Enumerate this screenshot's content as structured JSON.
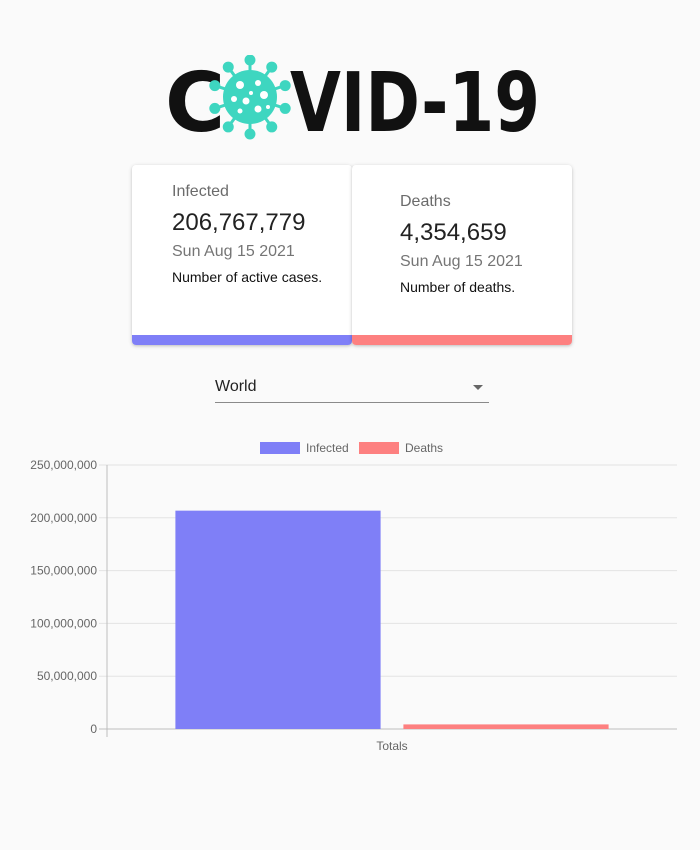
{
  "logo": {
    "text_left": "C",
    "text_right": "VID-19",
    "virus_color": "#3ed6c0"
  },
  "cards": [
    {
      "title": "Infected",
      "count": "206,767,779",
      "date": "Sun Aug 15 2021",
      "description": "Number of active cases.",
      "color": "#7f7ff7"
    },
    {
      "title": "Deaths",
      "count": "4,354,659",
      "date": "Sun Aug 15 2021",
      "description": "Number of deaths.",
      "color": "#fd8080"
    }
  ],
  "country_select": {
    "selected": "World"
  },
  "chart_data": {
    "type": "bar",
    "categories": [
      "Totals"
    ],
    "series": [
      {
        "name": "Infected",
        "values": [
          206767779
        ],
        "color": "#7f7ff7"
      },
      {
        "name": "Deaths",
        "values": [
          4354659
        ],
        "color": "#fd8080"
      }
    ],
    "ylim": [
      0,
      250000000
    ],
    "yticks": [
      "0",
      "50,000,000",
      "100,000,000",
      "150,000,000",
      "200,000,000",
      "250,000,000"
    ],
    "ytick_values": [
      0,
      50000000,
      100000000,
      150000000,
      200000000,
      250000000
    ],
    "grid": true,
    "legend_position": "top"
  }
}
